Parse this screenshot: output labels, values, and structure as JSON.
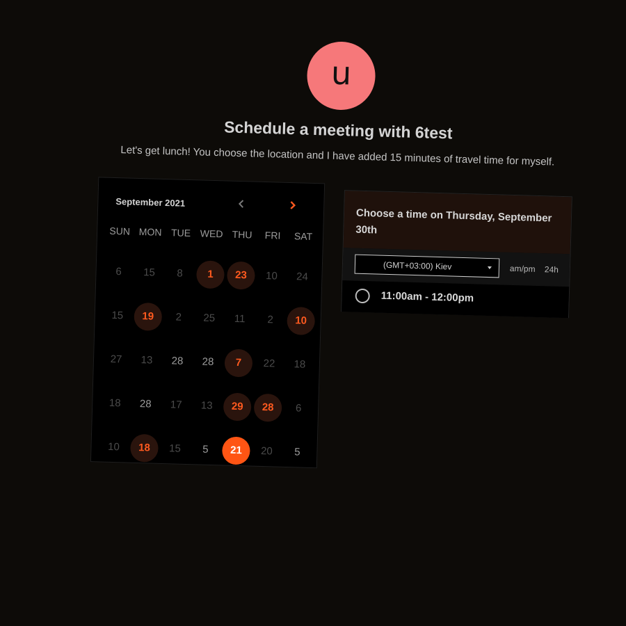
{
  "avatar": {
    "initial": "u",
    "color": "#f6787a"
  },
  "header": {
    "title": "Schedule a meeting with 6test",
    "subtitle": "Let's get lunch! You choose the location and I have added 15 minutes of travel time for myself."
  },
  "calendar": {
    "month_label": "September 2021",
    "prev_icon": "chevron-left-icon",
    "next_icon": "chevron-right-icon",
    "weekdays": [
      "SUN",
      "MON",
      "TUE",
      "WED",
      "THU",
      "FRI",
      "SAT"
    ],
    "accent_color": "#ff5514",
    "days": [
      {
        "label": "6",
        "state": "muted"
      },
      {
        "label": "15",
        "state": "muted"
      },
      {
        "label": "8",
        "state": "muted"
      },
      {
        "label": "1",
        "state": "available"
      },
      {
        "label": "23",
        "state": "available"
      },
      {
        "label": "10",
        "state": "muted"
      },
      {
        "label": "24",
        "state": "muted"
      },
      {
        "label": "15",
        "state": "muted"
      },
      {
        "label": "19",
        "state": "available"
      },
      {
        "label": "2",
        "state": "muted"
      },
      {
        "label": "25",
        "state": "muted"
      },
      {
        "label": "11",
        "state": "muted"
      },
      {
        "label": "2",
        "state": "muted"
      },
      {
        "label": "10",
        "state": "available"
      },
      {
        "label": "27",
        "state": "muted"
      },
      {
        "label": "13",
        "state": "muted"
      },
      {
        "label": "28",
        "state": "plain"
      },
      {
        "label": "28",
        "state": "plain"
      },
      {
        "label": "7",
        "state": "available"
      },
      {
        "label": "22",
        "state": "muted"
      },
      {
        "label": "18",
        "state": "muted"
      },
      {
        "label": "18",
        "state": "muted"
      },
      {
        "label": "28",
        "state": "plain"
      },
      {
        "label": "17",
        "state": "muted"
      },
      {
        "label": "13",
        "state": "muted"
      },
      {
        "label": "29",
        "state": "available"
      },
      {
        "label": "28",
        "state": "available"
      },
      {
        "label": "6",
        "state": "muted"
      },
      {
        "label": "10",
        "state": "muted"
      },
      {
        "label": "18",
        "state": "available"
      },
      {
        "label": "15",
        "state": "muted"
      },
      {
        "label": "5",
        "state": "plain"
      },
      {
        "label": "21",
        "state": "selected"
      },
      {
        "label": "20",
        "state": "muted"
      },
      {
        "label": "5",
        "state": "plain"
      }
    ]
  },
  "time_panel": {
    "heading": "Choose a time on Thursday, September 30th",
    "timezone": "(GMT+03:00) Kiev",
    "format_ampm": "am/pm",
    "format_24h": "24h",
    "slots": [
      {
        "label": "11:00am - 12:00pm"
      }
    ]
  }
}
